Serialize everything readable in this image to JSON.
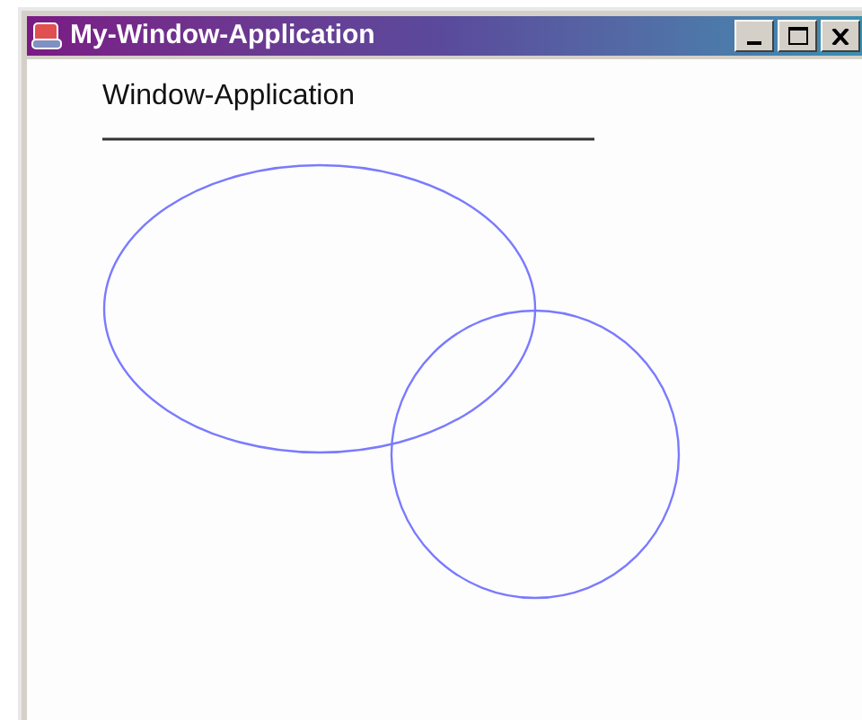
{
  "window": {
    "title": "My-Window-Application"
  },
  "content": {
    "heading": "Window-Application"
  }
}
